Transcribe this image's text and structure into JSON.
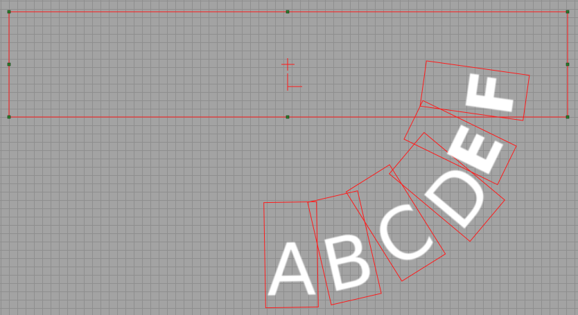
{
  "editor": {
    "background_color": "#a3a3a3",
    "grid_color": "#8e8e8e",
    "frame_color": "#ff1a1a",
    "handle_color": "#2c7a2c"
  },
  "text_on_path": {
    "letters": [
      {
        "char": "A"
      },
      {
        "char": "B"
      },
      {
        "char": "C"
      },
      {
        "char": "D"
      },
      {
        "char": "E"
      },
      {
        "char": "F"
      }
    ]
  }
}
